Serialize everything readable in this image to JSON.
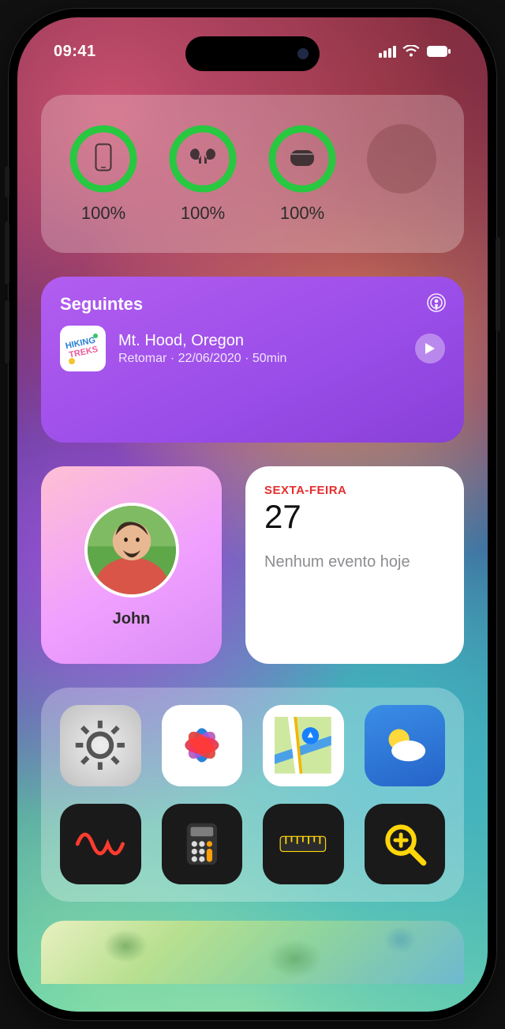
{
  "status": {
    "time": "09:41"
  },
  "batteries": {
    "items": [
      {
        "icon": "phone",
        "pct": "100%"
      },
      {
        "icon": "airpods",
        "pct": "100%"
      },
      {
        "icon": "case",
        "pct": "100%"
      }
    ]
  },
  "podcast": {
    "header": "Seguintes",
    "episode": {
      "title": "Mt. Hood, Oregon",
      "meta": "Retomar · 22/06/2020 · 50min"
    }
  },
  "contact": {
    "name": "John"
  },
  "calendar": {
    "weekday": "SEXTA-FEIRA",
    "day": "27",
    "message": "Nenhum evento hoje"
  },
  "apps": [
    {
      "name": "settings"
    },
    {
      "name": "photos"
    },
    {
      "name": "maps"
    },
    {
      "name": "weather"
    },
    {
      "name": "voice-memos"
    },
    {
      "name": "calculator"
    },
    {
      "name": "measure"
    },
    {
      "name": "magnifier"
    }
  ]
}
